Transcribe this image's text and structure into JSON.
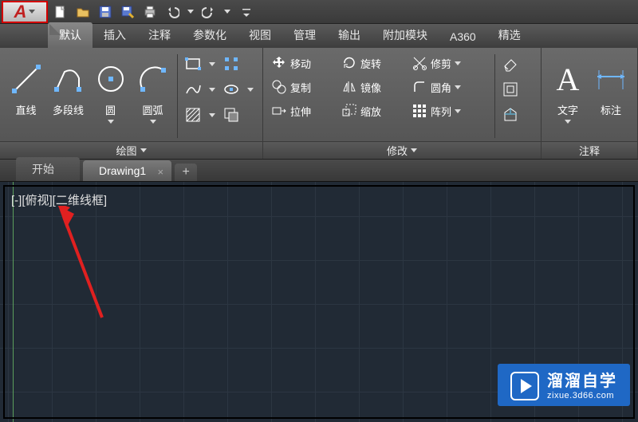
{
  "quick_access": {
    "app_menu_letter": "A",
    "buttons": [
      "new-icon",
      "open-icon",
      "save-icon",
      "saveas-icon",
      "print-icon",
      "undo-icon",
      "redo-icon"
    ]
  },
  "ribbon_tabs": [
    "默认",
    "插入",
    "注释",
    "参数化",
    "视图",
    "管理",
    "输出",
    "附加模块",
    "A360",
    "精选"
  ],
  "ribbon_tabs_active_index": 0,
  "panels": {
    "draw": {
      "title": "绘图",
      "line": "直线",
      "polyline": "多段线",
      "circle": "圆",
      "arc": "圆弧"
    },
    "modify": {
      "title": "修改",
      "move": "移动",
      "copy": "复制",
      "stretch": "拉伸",
      "rotate": "旋转",
      "mirror": "镜像",
      "scale": "缩放",
      "trim": "修剪",
      "fillet": "圆角",
      "array": "阵列"
    },
    "annotate": {
      "title": "注释",
      "text": "文字",
      "dim": "标注"
    }
  },
  "file_tabs": {
    "items": [
      {
        "label": "开始",
        "closable": false
      },
      {
        "label": "Drawing1",
        "closable": true
      }
    ],
    "active_index": 1
  },
  "viewport": {
    "label": "[-][俯视][二维线框]"
  },
  "watermark": {
    "brand": "溜溜自学",
    "url": "zixue.3d66.com"
  }
}
